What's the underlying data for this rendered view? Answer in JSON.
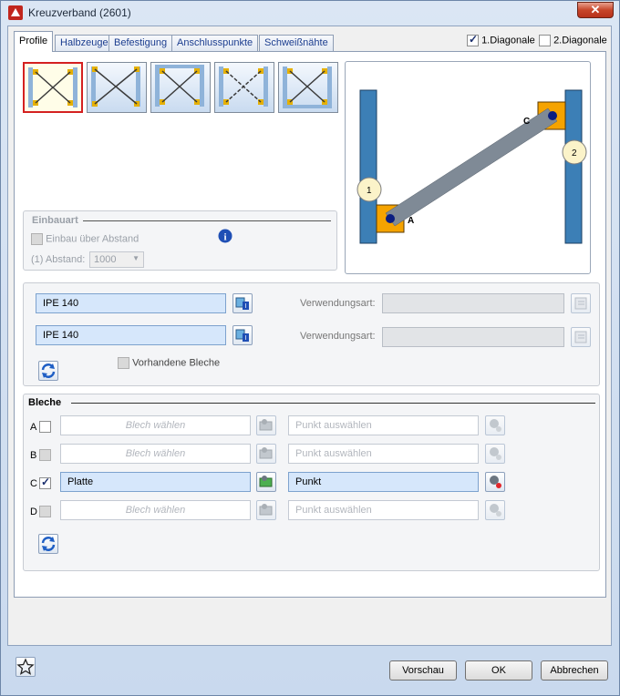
{
  "window": {
    "title": "Kreuzverband (2601)",
    "close_glyph": "✕"
  },
  "tabs": [
    "Profile",
    "Halbzeuge",
    "Befestigung",
    "Anschlusspunkte",
    "Schweißnähte"
  ],
  "diagonals": [
    {
      "label": "1.Diagonale",
      "checked": true
    },
    {
      "label": "2.Diagonale",
      "checked": false
    }
  ],
  "preview": {
    "labels": [
      "C",
      "A",
      "1",
      "2"
    ]
  },
  "einbauart": {
    "title": "Einbauart",
    "checkbox_label": "Einbau über Abstand",
    "distance_label": "(1) Abstand:",
    "distance_value": "1000"
  },
  "profiles": [
    {
      "value": "IPE 140",
      "usage_label": "Verwendungsart:",
      "usage_value": ""
    },
    {
      "value": "IPE 140",
      "usage_label": "Verwendungsart:",
      "usage_value": ""
    }
  ],
  "existing_plates_label": "Vorhandene Bleche",
  "bleche": {
    "title": "Bleche",
    "rows": [
      {
        "letter": "A",
        "checked": false,
        "plate": "Blech wählen",
        "point": "Punkt auswählen",
        "active": false
      },
      {
        "letter": "B",
        "checked": false,
        "plate": "Blech wählen",
        "point": "Punkt auswählen",
        "active": false
      },
      {
        "letter": "C",
        "checked": true,
        "plate": "Platte",
        "point": "Punkt",
        "active": true
      },
      {
        "letter": "D",
        "checked": false,
        "plate": "Blech wählen",
        "point": "Punkt auswählen",
        "active": false
      }
    ]
  },
  "footer": {
    "preview": "Vorschau",
    "ok": "OK",
    "cancel": "Abbrechen"
  },
  "colors": {
    "column": "#3c7fb6",
    "plate": "#f5a300",
    "brace": "#7f8a96",
    "accent": "#1b3d8f"
  }
}
